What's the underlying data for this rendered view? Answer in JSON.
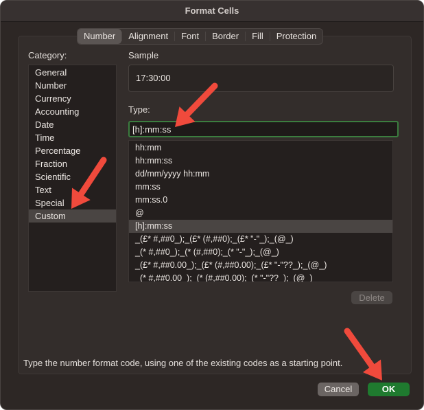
{
  "window": {
    "title": "Format Cells"
  },
  "tabs": [
    "Number",
    "Alignment",
    "Font",
    "Border",
    "Fill",
    "Protection"
  ],
  "active_tab": "Number",
  "category": {
    "label": "Category:",
    "items": [
      "General",
      "Number",
      "Currency",
      "Accounting",
      "Date",
      "Time",
      "Percentage",
      "Fraction",
      "Scientific",
      "Text",
      "Special",
      "Custom"
    ],
    "selected": "Custom"
  },
  "sample": {
    "label": "Sample",
    "value": "17:30:00"
  },
  "type": {
    "label": "Type:",
    "value": "[h]:mm:ss",
    "formats": [
      "hh:mm",
      "hh:mm:ss",
      "dd/mm/yyyy hh:mm",
      "mm:ss",
      "mm:ss.0",
      "@",
      "[h]:mm:ss",
      "_(£* #,##0_);_(£* (#,##0);_(£* \"-\"_);_(@_)",
      "_(* #,##0_);_(* (#,##0);_(* \"-\"_);_(@_)",
      "_(£* #,##0.00_);_(£* (#,##0.00);_(£* \"-\"??_);_(@_)",
      "_(* #,##0.00_);_(* (#,##0.00);_(* \"-\"??_);_(@_)"
    ],
    "selected": "[h]:mm:ss"
  },
  "buttons": {
    "delete": "Delete",
    "cancel": "Cancel",
    "ok": "OK"
  },
  "hint": "Type the number format code, using one of the existing codes as a starting point.",
  "colors": {
    "arrow": "#f04a3c",
    "accent_green": "#1f7a2f",
    "focus_green": "#3b7d3f"
  }
}
